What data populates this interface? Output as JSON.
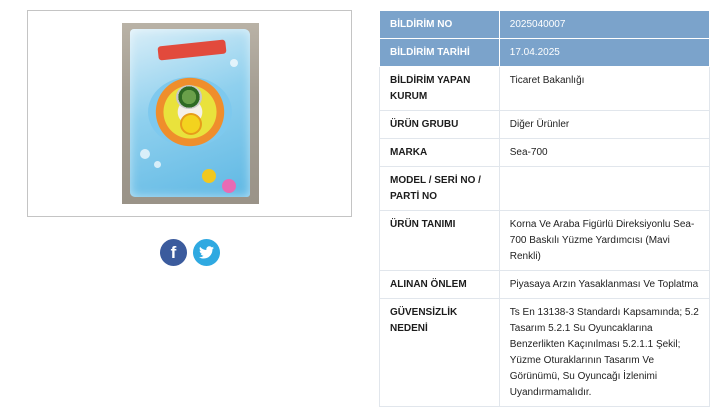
{
  "product_photo": {
    "alt": "Korna Ve Araba Figürlü Direksiyonlu Sea-700 Baskılı Yüzme Yardımcısı (Mavi Renkli)"
  },
  "share": {
    "facebook_glyph": "f",
    "twitter_glyph": "🐦"
  },
  "rows": [
    {
      "label": "BİLDİRİM NO",
      "value": "2025040007",
      "highlight": true
    },
    {
      "label": "BİLDİRİM TARİHİ",
      "value": "17.04.2025",
      "highlight": true
    },
    {
      "label": "BİLDİRİM YAPAN KURUM",
      "value": "Ticaret Bakanlığı",
      "highlight": false
    },
    {
      "label": "ÜRÜN GRUBU",
      "value": "Diğer Ürünler",
      "highlight": false
    },
    {
      "label": "MARKA",
      "value": "Sea-700",
      "highlight": false
    },
    {
      "label": "MODEL / SERİ NO / PARTİ NO",
      "value": "",
      "highlight": false
    },
    {
      "label": "ÜRÜN TANIMI",
      "value": "Korna Ve Araba Figürlü Direksiyonlu Sea-700 Baskılı Yüzme Yardımcısı (Mavi Renkli)",
      "highlight": false
    },
    {
      "label": "ALINAN ÖNLEM",
      "value": "Piyasaya Arzın Yasaklanması Ve Toplatma",
      "highlight": false
    },
    {
      "label": "GÜVENSİZLİK NEDENİ",
      "value": "Ts En 13138-3 Standardı Kapsamında; 5.2 Tasarım 5.2.1 Su Oyuncaklarına Benzerlikten Kaçınılması 5.2.1.1 Şekil; Yüzme Oturaklarının Tasarım Ve Görünümü, Su Oyuncağı İzlenimi Uyandırmamalıdır.",
      "highlight": false
    }
  ],
  "colors": {
    "header_row_bg": "#7ba3cb",
    "facebook": "#3b5b9d",
    "twitter": "#2fa9e1"
  }
}
